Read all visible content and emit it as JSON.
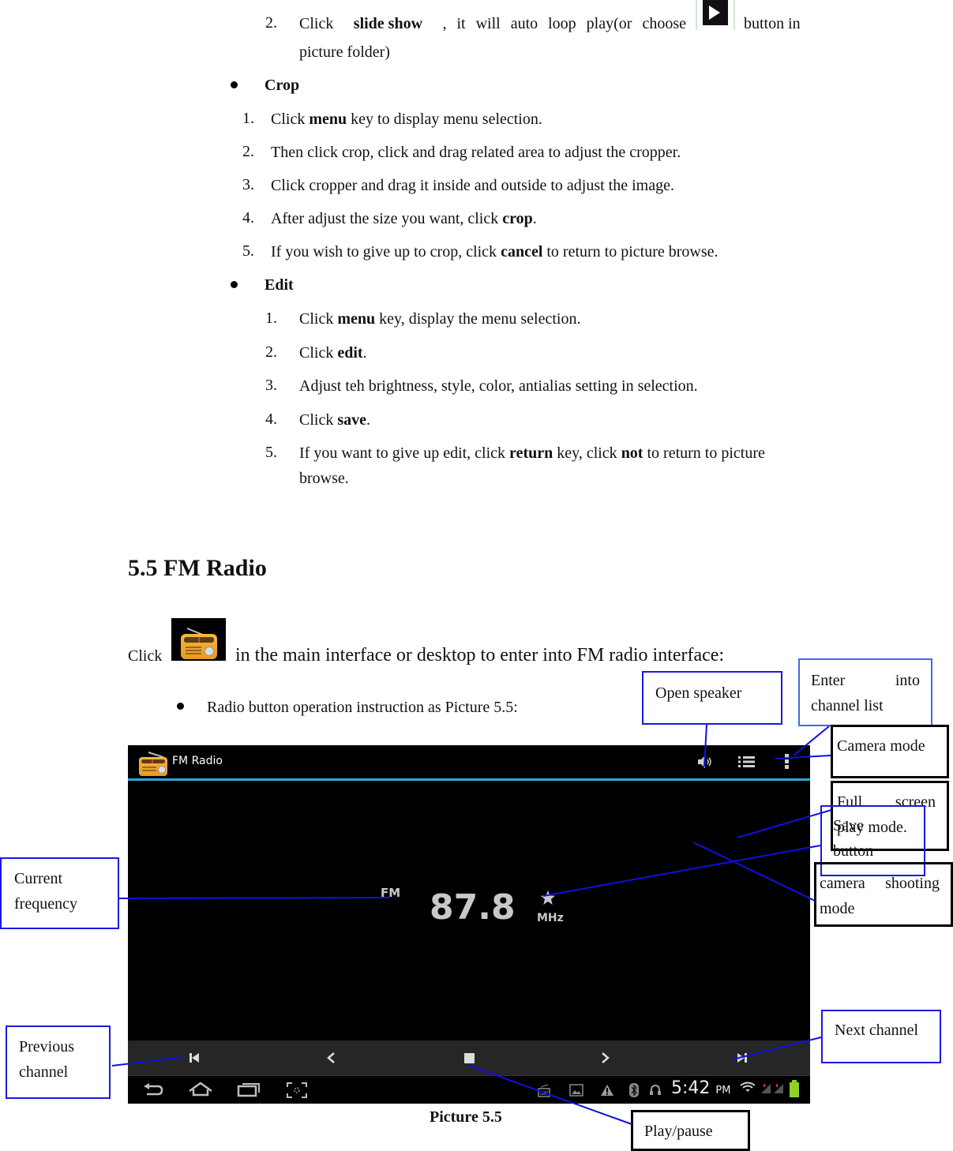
{
  "gallery": {
    "slideshow_item": {
      "number": "2.",
      "pre": "Click ",
      "bold": "slide show",
      "post": ", it will auto loop play(or choose",
      "after_icon": "button in",
      "line2": "picture folder)",
      "icon": "play-button-icon"
    },
    "crop": {
      "heading": "Crop",
      "steps": [
        {
          "n": "1.",
          "pre": "Click ",
          "bold": "menu",
          "post": " key to display menu selection."
        },
        {
          "n": "2.",
          "pre": "Then click crop, click and drag related area to adjust the cropper.",
          "bold": "",
          "post": ""
        },
        {
          "n": "3.",
          "pre": "Click cropper and drag it inside and outside to adjust the image.",
          "bold": "",
          "post": ""
        },
        {
          "n": "4.",
          "pre": "After adjust the size you want, click ",
          "bold": "crop",
          "post": "."
        },
        {
          "n": "5.",
          "pre": "If you wish to give up to crop, click ",
          "bold": "cancel",
          "post": " to return to picture browse."
        }
      ]
    },
    "edit": {
      "heading": "Edit",
      "steps": [
        {
          "n": "1.",
          "pre": "Click ",
          "bold": "menu",
          "post": " key, display the menu selection."
        },
        {
          "n": "2.",
          "pre": "Click ",
          "bold": "edit",
          "post": "."
        },
        {
          "n": "3.",
          "pre": "Adjust teh brightness, style, color, antialias setting in selection.",
          "bold": "",
          "post": ""
        },
        {
          "n": "4.",
          "pre": "Click ",
          "bold": "save",
          "post": "."
        },
        {
          "n": "5.",
          "pre": "If you want to give up edit, click ",
          "bold": "return",
          "mid": " key, click ",
          "bold2": "not",
          "post": " to return to picture",
          "line2": "browse."
        }
      ]
    }
  },
  "section": {
    "title": "5.5 FM Radio",
    "intro_pre": "Click",
    "intro_post": "in the main interface or desktop to enter into FM radio interface:",
    "intro_icon": "fm-radio-app-icon",
    "bullet": "Radio button operation instruction as Picture 5.5:"
  },
  "screen": {
    "app_title": "FM Radio",
    "band": "FM",
    "frequency": "87.8",
    "unit": "MHz",
    "actionbar_icons": [
      "speaker-icon",
      "channel-list-icon",
      "overflow-menu-icon"
    ],
    "control_icons": [
      "previous-channel-icon",
      "seek-back-icon",
      "stop-play-icon",
      "seek-forward-icon",
      "next-channel-icon"
    ],
    "nav_icons": [
      "back-icon",
      "home-icon",
      "recent-apps-icon",
      "screenshot-icon"
    ],
    "status_icons": [
      "radio-notification-icon",
      "gallery-notification-icon",
      "warning-icon",
      "bluetooth-icon",
      "headset-icon",
      "wifi-icon",
      "signal-icon",
      "battery-icon"
    ],
    "time": "5:42",
    "ampm": "PM",
    "accent_color": "#35a2d4",
    "battery_color": "#8fd12a"
  },
  "callouts": {
    "open_speaker": "Open speaker",
    "channel_list": "Enter into channel list",
    "channel_list_l1": "Enter",
    "channel_list_l1b": "into",
    "channel_list_l2": "channel list",
    "camera_mode": "Camera mode",
    "full_screen_l1": "Full",
    "full_screen_l1b": "screen",
    "full_screen_l2": "play mode.",
    "save_l1": "Save",
    "save_l2": "button",
    "camera_shooting_l1": "camera",
    "camera_shooting_l1b": "shooting",
    "camera_shooting_l2": "mode",
    "current_frequency_l1": "Current",
    "current_frequency_l2": "frequency",
    "previous_channel_l1": "Previous",
    "previous_channel_l2": "channel",
    "next_channel": "Next channel",
    "play_pause": "Play/pause"
  },
  "caption": "Picture 5.5"
}
